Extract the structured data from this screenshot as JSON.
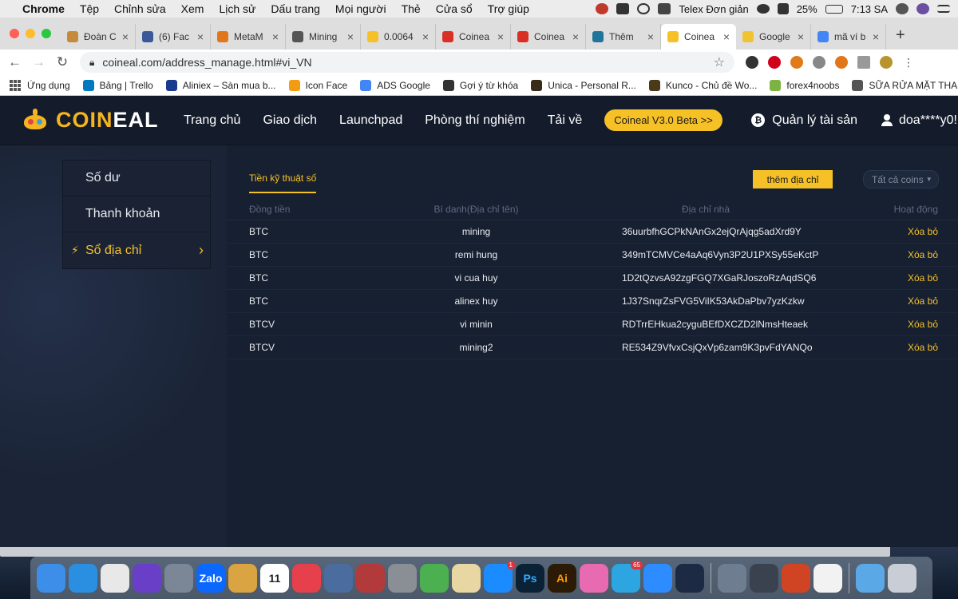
{
  "menubar": {
    "app": "Chrome",
    "items": [
      "Tệp",
      "Chỉnh sửa",
      "Xem",
      "Lịch sử",
      "Dấu trang",
      "Mọi người",
      "Thẻ",
      "Cửa sổ",
      "Trợ giúp"
    ],
    "input_method": "Telex Đơn giản",
    "battery": "25%",
    "time": "7:13 SA"
  },
  "tabs": [
    {
      "label": "Đoàn C",
      "color": "#c58a3b"
    },
    {
      "label": "(6) Fac",
      "color": "#3b5998"
    },
    {
      "label": "MetaM",
      "color": "#e2761b"
    },
    {
      "label": "Mining",
      "color": "#555555"
    },
    {
      "label": "0.0064",
      "color": "#f6c126"
    },
    {
      "label": "Coinea",
      "color": "#d93025"
    },
    {
      "label": "Coinea",
      "color": "#d93025"
    },
    {
      "label": "Thêm ",
      "color": "#21759b"
    },
    {
      "label": "Coinea",
      "color": "#f6c126"
    },
    {
      "label": "Google",
      "color": "#f1c232"
    },
    {
      "label": "mã ví b",
      "color": "#4285f4"
    }
  ],
  "active_tab_index": 8,
  "address": {
    "url": "coineal.com/address_manage.html#vi_VN"
  },
  "bookmarks": [
    {
      "label": "Ứng dụng",
      "color": "apps"
    },
    {
      "label": "Bảng | Trello",
      "color": "#0079bf"
    },
    {
      "label": "Aliniex – Sàn mua b...",
      "color": "#1a3a8f"
    },
    {
      "label": "Icon Face",
      "color": "#f39c12"
    },
    {
      "label": "ADS Google",
      "color": "#4285f4"
    },
    {
      "label": "Gợi ý từ khóa",
      "color": "#333333"
    },
    {
      "label": "Unica - Personal R...",
      "color": "#3a2a1a"
    },
    {
      "label": "Kunco - Chủ đề Wo...",
      "color": "#4a3a1a"
    },
    {
      "label": "forex4noobs",
      "color": "#7cb342"
    },
    {
      "label": "SỮA RỬA MẶT THA...",
      "color": "#555555"
    }
  ],
  "site": {
    "logo_main": "COIN",
    "logo_accent": "EAL",
    "nav": [
      "Trang chủ",
      "Giao dịch",
      "Launchpad",
      "Phòng thí nghiệm",
      "Tải về"
    ],
    "beta_button": "Coineal V3.0 Beta >>",
    "asset_menu": "Quản lý tài sản",
    "user": "doa****y0!"
  },
  "sidebar": {
    "items": [
      {
        "label": "Số dư"
      },
      {
        "label": "Thanh khoản"
      },
      {
        "label": "Sổ địa chỉ"
      }
    ]
  },
  "content": {
    "tab_label": "Tiền kỹ thuật số",
    "add_button": "thêm địa chỉ",
    "filter_value": "Tất cả coins",
    "columns": [
      "Đồng tiền",
      "Bí danh(Địa chỉ tên)",
      "Địa chỉ nhà",
      "Hoạt động"
    ],
    "rows": [
      {
        "coin": "BTC",
        "alias": "mining",
        "address": "36uurbfhGCPkNAnGx2ejQrAjqg5adXrd9Y",
        "action": "Xóa bỏ"
      },
      {
        "coin": "BTC",
        "alias": "remi hung",
        "address": "349mTCMVCe4aAq6Vyn3P2U1PXSy55eKctP",
        "action": "Xóa bỏ"
      },
      {
        "coin": "BTC",
        "alias": "vi cua huy",
        "address": "1D2tQzvsA92zgFGQ7XGaRJoszoRzAqdSQ6",
        "action": "Xóa bỏ"
      },
      {
        "coin": "BTC",
        "alias": "alinex huy",
        "address": "1J37SnqrZsFVG5ViIK53AkDaPbv7yzKzkw",
        "action": "Xóa bỏ"
      },
      {
        "coin": "BTCV",
        "alias": "vi minin",
        "address": "RDTrrEHkua2cyguBEfDXCZD2lNmsHteaek",
        "action": "Xóa bỏ"
      },
      {
        "coin": "BTCV",
        "alias": "mining2",
        "address": "RE534Z9VfvxCsjQxVp6zam9K3pvFdYANQo",
        "action": "Xóa bỏ"
      }
    ]
  },
  "dock": {
    "apps": [
      {
        "name": "finder",
        "color": "#3d8ee8"
      },
      {
        "name": "safari",
        "color": "#2a8fe0"
      },
      {
        "name": "chrome",
        "color": "#e8e8e8"
      },
      {
        "name": "siri",
        "color": "#6a3fc8"
      },
      {
        "name": "launchpad",
        "color": "#7b8796"
      },
      {
        "name": "zalo",
        "color": "#0a68ff",
        "label": "Zalo"
      },
      {
        "name": "notes",
        "color": "#d9a441"
      },
      {
        "name": "calendar",
        "color": "#ffffff",
        "label": "11"
      },
      {
        "name": "app-red",
        "color": "#e5404b"
      },
      {
        "name": "monitor",
        "color": "#4b6c9e"
      },
      {
        "name": "photo-booth",
        "color": "#b23a3a"
      },
      {
        "name": "system-preferences",
        "color": "#8a8f96"
      },
      {
        "name": "maps",
        "color": "#4caf50"
      },
      {
        "name": "preview",
        "color": "#e8d7a3"
      },
      {
        "name": "app-store",
        "color": "#1a8cff",
        "badge": "1"
      },
      {
        "name": "photoshop",
        "color": "#0b2236",
        "label": "Ps"
      },
      {
        "name": "illustrator",
        "color": "#2b1a05",
        "label": "Ai"
      },
      {
        "name": "folder-pink",
        "color": "#e86ab0"
      },
      {
        "name": "telegram",
        "color": "#2ca5e0",
        "badge": "65"
      },
      {
        "name": "zoom",
        "color": "#2d8cff"
      },
      {
        "name": "react",
        "color": "#1d2a44"
      },
      {
        "name": "image-capture",
        "color": "#6e7d90"
      },
      {
        "name": "quicktime",
        "color": "#3a4250"
      },
      {
        "name": "powerpoint",
        "color": "#d04423"
      },
      {
        "name": "word-doc",
        "color": "#f2f2f2"
      },
      {
        "name": "downloads-folder",
        "color": "#5aa9e6"
      },
      {
        "name": "trash",
        "color": "#c9ced6"
      }
    ]
  }
}
